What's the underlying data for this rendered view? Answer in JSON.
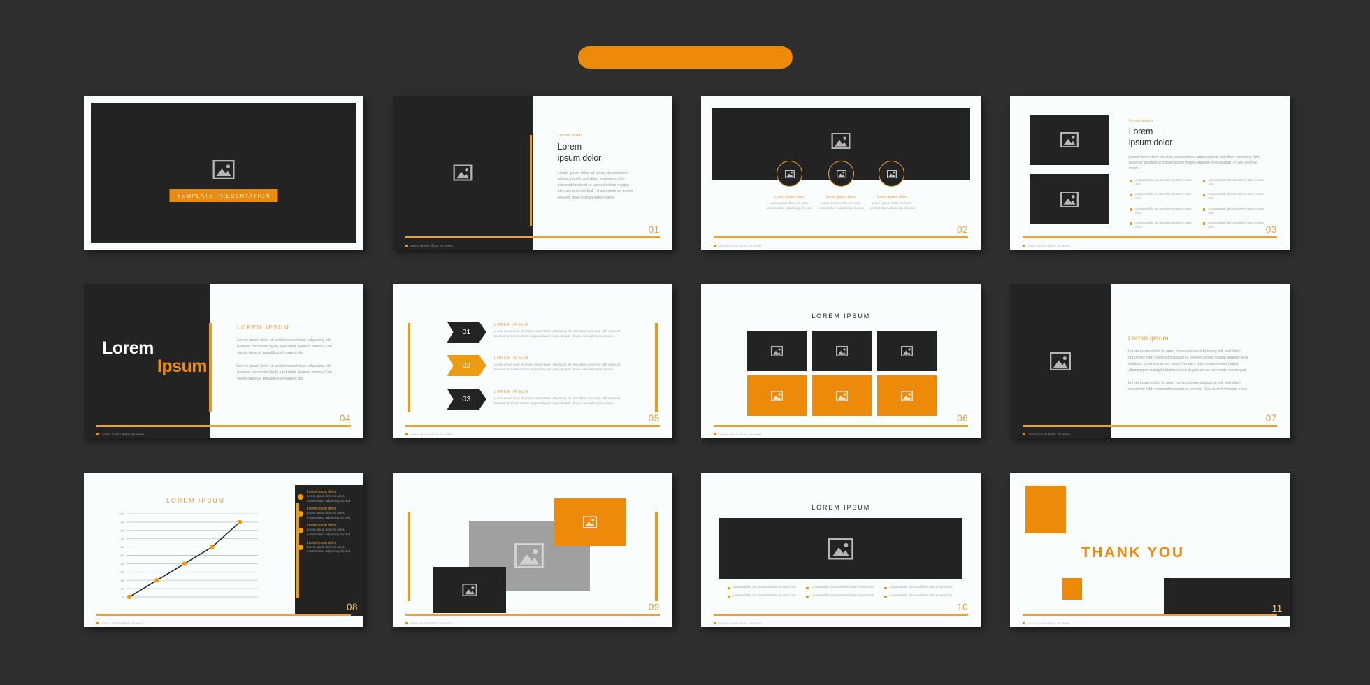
{
  "theme": {
    "background": "#2e2e2e",
    "accent_orange": "#ee8a09",
    "accent_gold": "#e0a23f",
    "dark_slide": "#232323",
    "light_slide": "#fafdfd",
    "muted_text": "#9b9b9b"
  },
  "top_banner": {
    "label": ""
  },
  "common": {
    "footer_note": "Lorem ipsum dolor sit amet.",
    "eyebrow": "Lorem ipsum",
    "heading_line1": "Lorem",
    "heading_line2": "ipsum dolor",
    "body_paragraph": "Lorem ipsum dolor sit amet, consectetuer adipiscing elit, sed diam nonummy nibh euismod tincidunt ut laoreet dolore magna aliquam erat volutpat. Ut wisi enim ad minim veniam, quis nostrud exerci tation",
    "bullet_text": "Loripavailable, but mosuffered ation in some form.",
    "image_icon": "image-placeholder-icon"
  },
  "slides": [
    {
      "id": "cover",
      "number": "",
      "title_button": "TEMPLATE PRESENTATION",
      "icon": "image-placeholder-icon"
    },
    {
      "id": "slide-01",
      "number": "01",
      "eyebrow": "Lorem ipsum",
      "heading_line1": "Lorem",
      "heading_line2": "ipsum dolor",
      "body": "Lorem ipsum dolor sit amet, consectetuer adipiscing elit, sed diam nonummy nibh euismod tincidunt ut laoreet dolore magna aliquam erat volutpat. Ut wisi enim ad minim veniam, quis nostrud exerci tation",
      "footer": "Lorem ipsum dolor sit amet."
    },
    {
      "id": "slide-02",
      "number": "02",
      "footer": "Lorem ipsum dolor sit amet.",
      "columns": [
        {
          "heading": "Lorem ipsum dolor",
          "body": "Lorem ipsum dolor sit amet, consectetuer adipiscing elit, sed"
        },
        {
          "heading": "Lorem ipsum dolor",
          "body": "Lorem ipsum dolor sit amet, consectetuer adipiscing elit, sed"
        },
        {
          "heading": "Lorem ipsum dolor",
          "body": "Lorem ipsum dolor sit amet, consectetuer adipiscing elit, sed"
        }
      ]
    },
    {
      "id": "slide-03",
      "number": "03",
      "eyebrow": "Lorem ipsum",
      "heading_line1": "Lorem",
      "heading_line2": "ipsum dolor",
      "body": "Lorem ipsum dolor sit amet, consectetuer adipiscing elit, sed diam nonummy nibh euismod tincidunt ut laoreet dolore magna aliquam erat volutpat. Ut wisi enim ad minim",
      "bullets": [
        "Loripavailable, but mosuffered ation in some form.",
        "Loripavailable, but mosuffered ation in some form.",
        "Loripavailable, but mosuffered ation in some form.",
        "Loripavailable, but mosuffered ation in some form.",
        "Loripavailable, but mosuffered ation in some form.",
        "Loripavailable, but mosuffered ation in some form.",
        "Loripavailable, but mosuffered ation in some form.",
        "Loripavailable, but mosuffered ation in some form."
      ],
      "footer": "Lorem ipsum dolor sit amet."
    },
    {
      "id": "slide-04",
      "number": "04",
      "title_white": "Lorem",
      "title_orange": "Ipsum",
      "caption": "LOREM IPSUM",
      "paragraph1": "Lorem ipsum dolor sit amet consectetuer adipiscing elit Aenean commodo ligula eget dolor Aenean massa Cum sociis natoque penatibus et magnis dis",
      "paragraph2": "Lorem ipsum dolor sit amet consectetuer adipiscing elit Aenean commodo ligula eget dolor Aenean massa Cum sociis natoque penatibus et magnis dis",
      "footer": "Lorem ipsum dolor sit amet."
    },
    {
      "id": "slide-05",
      "number": "05",
      "footer": "Lorem ipsum dolor sit amet.",
      "items": [
        {
          "num": "01",
          "style": "dark",
          "heading": "LOREM IPSUM",
          "body": "Lorem ipsum dolor sit amet, consectetuer adipiscing elit, sed diam nonummy nibh euismod tincidunt ut laoreet dolore magna aliquam erat volutpat. Ut wisi enim ad minim veniam,"
        },
        {
          "num": "02",
          "style": "orange",
          "heading": "LOREM IPSUM",
          "body": "Lorem ipsum dolor sit amet, consectetuer adipiscing elit, sed diam nonummy nibh euismod tincidunt ut laoreet dolore magna aliquam erat volutpat. Ut wisi enim ad minim veniam,"
        },
        {
          "num": "03",
          "style": "dark",
          "heading": "LOREM IPSUM",
          "body": "Lorem ipsum dolor sit amet, consectetuer adipiscing elit, sed diam nonummy nibh euismod tincidunt ut laoreet dolore magna aliquam erat volutpat. Ut wisi enim ad minim veniam,"
        }
      ]
    },
    {
      "id": "slide-06",
      "number": "06",
      "title": "LOREM IPSUM",
      "footer": "Lorem ipsum dolor sit amet.",
      "tiles": [
        "dark",
        "dark",
        "dark",
        "orange",
        "orange",
        "orange"
      ]
    },
    {
      "id": "slide-07",
      "number": "07",
      "heading": "Lorem ipsum",
      "paragraph1": "Lorem ipsum dolor sit amet, consectetuer adipiscing elit, sed diam nonummy nibh euismod tincidunt ut laoreet dolore magna aliquam erat volutpat. Ut wisi enim ad minim veniam, quis nostrud exerci tation ullamcorper suscipit lobortis nisl ut aliquip ex ea commodo consequat.",
      "paragraph2": "Lorem ipsum dolor sit amet, consectetuer adipiscing elit, sed diam nonummy nibh euismod tincidunt ut laoreet. Duis autem vel eum iriure",
      "footer": "Lorem ipsum dolor sit amet."
    },
    {
      "id": "slide-08",
      "number": "08",
      "title": "LOREM IPSUM",
      "footer": "Lorem ipsum dolor sit amet.",
      "panel_items": [
        {
          "heading": "Lorem ipsum dolor",
          "body": "Lorem ipsum dolor sit amet, consectetuer adipiscing elit, sed"
        },
        {
          "heading": "Lorem ipsum dolor",
          "body": "Lorem ipsum dolor sit amet, consectetuer adipiscing elit, sed"
        },
        {
          "heading": "Lorem ipsum dolor",
          "body": "Lorem ipsum dolor sit amet, consectetuer adipiscing elit, sed"
        },
        {
          "heading": "Lorem ipsum dolor",
          "body": "Lorem ipsum dolor sit amet, consectetuer adipiscing elit, sed"
        }
      ]
    },
    {
      "id": "slide-09",
      "number": "09",
      "footer": "Lorem ipsum dolor sit amet."
    },
    {
      "id": "slide-10",
      "number": "10",
      "title": "LOREM IPSUM",
      "footer": "Lorem ipsum dolor sit amet.",
      "bullets": [
        "Loripavailable, but mosuffered ation in some form.",
        "Loripavailable, but mosuffered ation in some form.",
        "Loripavailable, but mosuffered ation in some form.",
        "Loripavailable, but mosuffered ation in some form.",
        "Loripavailable, but mosuffered ation in some form.",
        "Loripavailable, but mosuffered ation in some form."
      ]
    },
    {
      "id": "slide-11",
      "number": "11",
      "thank_you": "THANK YOU",
      "footer": "Lorem ipsum dolor sit amet."
    }
  ],
  "chart_data": {
    "type": "line",
    "title": "LOREM IPSUM",
    "x": [
      0,
      1,
      2,
      3,
      4
    ],
    "values": [
      0,
      20,
      40,
      60,
      90
    ],
    "ytick_labels": [
      "100",
      "90",
      "80",
      "70",
      "60",
      "50",
      "40",
      "30",
      "20",
      "10",
      "0"
    ],
    "ylim": [
      0,
      100
    ],
    "xlabel": "",
    "ylabel": "",
    "grid": true,
    "legend": false,
    "line_color": "#232323",
    "marker_color": "#eb9c13"
  }
}
